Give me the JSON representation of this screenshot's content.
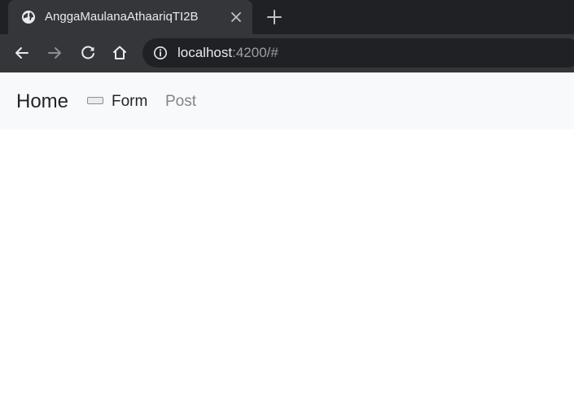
{
  "browser": {
    "tab": {
      "title": "AnggaMaulanaAthaariqTI2B",
      "favicon": "globe-icon"
    },
    "address_bar": {
      "host": "localhost",
      "rest": ":4200/#"
    },
    "icons": {
      "back": "arrow-left-icon",
      "forward": "arrow-right-icon",
      "reload": "reload-icon",
      "home": "home-icon",
      "info": "info-icon",
      "close": "close-icon",
      "new_tab": "plus-icon"
    },
    "colors": {
      "tabstrip": "#202124",
      "toolbar": "#35363a",
      "omnibox": "#202124"
    }
  },
  "navbar": {
    "brand": "Home",
    "links": [
      {
        "label": "Form"
      },
      {
        "label": "Post"
      }
    ],
    "colors": {
      "background": "#f8f9fa",
      "link_active": "#212529",
      "link_muted": "#7f868b"
    }
  }
}
